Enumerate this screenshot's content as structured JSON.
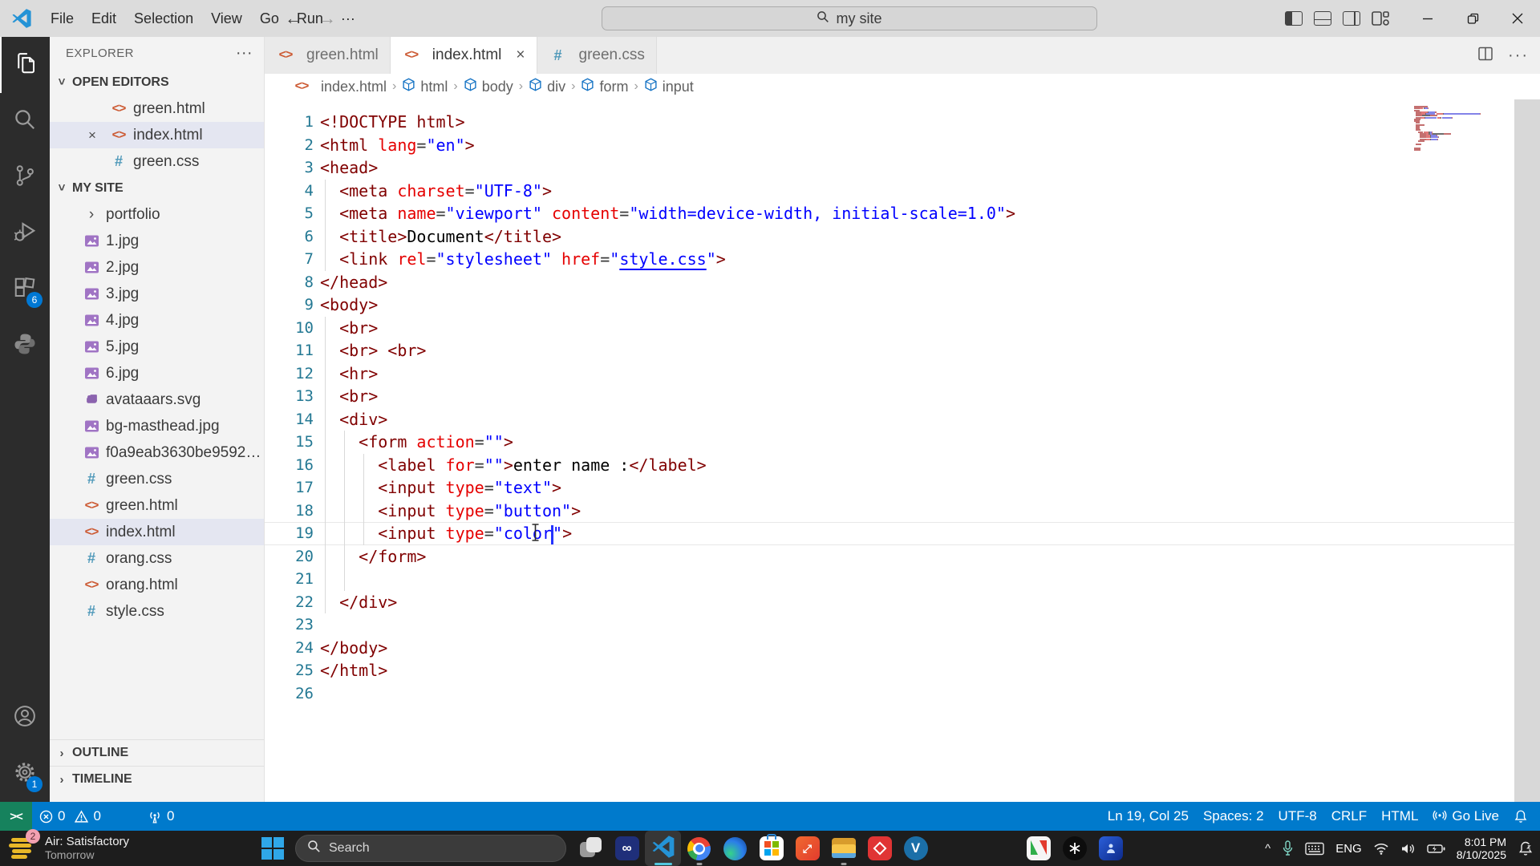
{
  "title_bar": {
    "menus": [
      "File",
      "Edit",
      "Selection",
      "View",
      "Go",
      "Run",
      "···"
    ],
    "back_icon": "←",
    "forward_icon": "→",
    "command_center": {
      "icon": "search-icon",
      "text": "my site"
    },
    "layout_icons": [
      "toggle-primary-sidebar-icon",
      "toggle-panel-icon",
      "toggle-secondary-sidebar-icon",
      "customize-layout-icon"
    ],
    "window_controls": [
      "minimize-icon",
      "restore-icon",
      "close-icon"
    ]
  },
  "activity_bar": {
    "top": [
      {
        "name": "explorer",
        "icon": "files-icon",
        "active": true
      },
      {
        "name": "search",
        "icon": "search-icon"
      },
      {
        "name": "source-control",
        "icon": "source-control-icon"
      },
      {
        "name": "run-debug",
        "icon": "run-debug-icon"
      },
      {
        "name": "extensions",
        "icon": "extensions-icon",
        "badge": "6"
      },
      {
        "name": "python",
        "icon": "python-icon"
      }
    ],
    "bottom": [
      {
        "name": "accounts",
        "icon": "account-icon"
      },
      {
        "name": "settings",
        "icon": "gear-icon",
        "badge": "1"
      }
    ]
  },
  "sidebar": {
    "title": "EXPLORER",
    "more_icon": "···",
    "open_editors": {
      "label": "OPEN EDITORS",
      "items": [
        {
          "label": "green.html",
          "icon": "html"
        },
        {
          "label": "index.html",
          "icon": "html",
          "close": true,
          "selected": true
        },
        {
          "label": "green.css",
          "icon": "css"
        }
      ]
    },
    "folder": {
      "label": "MY SITE",
      "items": [
        {
          "label": "portfolio",
          "icon": "folder"
        },
        {
          "label": "1.jpg",
          "icon": "image"
        },
        {
          "label": "2.jpg",
          "icon": "image"
        },
        {
          "label": "3.jpg",
          "icon": "image"
        },
        {
          "label": "4.jpg",
          "icon": "image"
        },
        {
          "label": "5.jpg",
          "icon": "image"
        },
        {
          "label": "6.jpg",
          "icon": "image"
        },
        {
          "label": "avataaars.svg",
          "icon": "svg"
        },
        {
          "label": "bg-masthead.jpg",
          "icon": "image"
        },
        {
          "label": "f0a9eab3630be95922...",
          "icon": "image"
        },
        {
          "label": "green.css",
          "icon": "css"
        },
        {
          "label": "green.html",
          "icon": "html"
        },
        {
          "label": "index.html",
          "icon": "html",
          "selected": true
        },
        {
          "label": "orang.css",
          "icon": "css"
        },
        {
          "label": "orang.html",
          "icon": "html"
        },
        {
          "label": "style.css",
          "icon": "css"
        }
      ]
    },
    "bottom_sections": [
      "OUTLINE",
      "TIMELINE"
    ]
  },
  "tabs": [
    {
      "label": "green.html",
      "icon": "html"
    },
    {
      "label": "index.html",
      "icon": "html",
      "active": true,
      "close": "×"
    },
    {
      "label": "green.css",
      "icon": "css"
    }
  ],
  "editor_actions": [
    "split-editor-icon",
    "more-actions-icon"
  ],
  "breadcrumb": [
    {
      "label": "index.html",
      "icon": "html"
    },
    {
      "label": "html",
      "icon": "symbol"
    },
    {
      "label": "body",
      "icon": "symbol"
    },
    {
      "label": "div",
      "icon": "symbol"
    },
    {
      "label": "form",
      "icon": "symbol"
    },
    {
      "label": "input",
      "icon": "symbol"
    }
  ],
  "editor": {
    "current_line": 19,
    "lines": [
      {
        "g": 0,
        "s": [
          [
            "tag",
            "<!DOCTYPE html>"
          ]
        ]
      },
      {
        "g": 0,
        "s": [
          [
            "tag",
            "<html "
          ],
          [
            "attr",
            "lang"
          ],
          [
            "pun",
            "="
          ],
          [
            "val",
            "\"en\""
          ],
          [
            "tag",
            ">"
          ]
        ]
      },
      {
        "g": 0,
        "s": [
          [
            "tag",
            "<head>"
          ]
        ]
      },
      {
        "g": 1,
        "s": [
          [
            "tag",
            "  <meta "
          ],
          [
            "attr",
            "charset"
          ],
          [
            "pun",
            "="
          ],
          [
            "val",
            "\"UTF-8\""
          ],
          [
            "tag",
            ">"
          ]
        ]
      },
      {
        "g": 1,
        "s": [
          [
            "tag",
            "  <meta "
          ],
          [
            "attr",
            "name"
          ],
          [
            "pun",
            "="
          ],
          [
            "val",
            "\"viewport\""
          ],
          [
            "attr",
            " content"
          ],
          [
            "pun",
            "="
          ],
          [
            "val",
            "\"width=device-width, initial-scale=1.0\""
          ],
          [
            "tag",
            ">"
          ]
        ]
      },
      {
        "g": 1,
        "s": [
          [
            "tag",
            "  <title>"
          ],
          [
            "txt",
            "Document"
          ],
          [
            "tag",
            "</title>"
          ]
        ]
      },
      {
        "g": 1,
        "s": [
          [
            "tag",
            "  <link "
          ],
          [
            "attr",
            "rel"
          ],
          [
            "pun",
            "="
          ],
          [
            "val",
            "\"stylesheet\""
          ],
          [
            "attr",
            " href"
          ],
          [
            "pun",
            "="
          ],
          [
            "val",
            "\""
          ],
          [
            "link",
            "style.css"
          ],
          [
            "val",
            "\""
          ],
          [
            "tag",
            ">"
          ]
        ]
      },
      {
        "g": 0,
        "s": [
          [
            "tag",
            "</head>"
          ]
        ]
      },
      {
        "g": 0,
        "s": [
          [
            "tag",
            "<body>"
          ]
        ]
      },
      {
        "g": 1,
        "s": [
          [
            "tag",
            "  <br>"
          ]
        ]
      },
      {
        "g": 1,
        "s": [
          [
            "tag",
            "  <br> <br>"
          ]
        ]
      },
      {
        "g": 1,
        "s": [
          [
            "tag",
            "  <hr>"
          ]
        ]
      },
      {
        "g": 1,
        "s": [
          [
            "tag",
            "  <br>"
          ]
        ]
      },
      {
        "g": 1,
        "s": [
          [
            "tag",
            "  <div>"
          ]
        ]
      },
      {
        "g": 2,
        "s": [
          [
            "tag",
            "    <form "
          ],
          [
            "attr",
            "action"
          ],
          [
            "pun",
            "="
          ],
          [
            "val",
            "\"\""
          ],
          [
            "tag",
            ">"
          ]
        ]
      },
      {
        "g": 3,
        "s": [
          [
            "tag",
            "      <label "
          ],
          [
            "attr",
            "for"
          ],
          [
            "pun",
            "="
          ],
          [
            "val",
            "\"\""
          ],
          [
            "tag",
            ">"
          ],
          [
            "txt",
            "enter name :"
          ],
          [
            "tag",
            "</label>"
          ]
        ]
      },
      {
        "g": 3,
        "s": [
          [
            "tag",
            "      <input "
          ],
          [
            "attr",
            "type"
          ],
          [
            "pun",
            "="
          ],
          [
            "val",
            "\"text\""
          ],
          [
            "tag",
            ">"
          ]
        ]
      },
      {
        "g": 3,
        "s": [
          [
            "tag",
            "      <input "
          ],
          [
            "attr",
            "type"
          ],
          [
            "pun",
            "="
          ],
          [
            "val",
            "\"button\""
          ],
          [
            "tag",
            ">"
          ]
        ]
      },
      {
        "g": 3,
        "s": [
          [
            "tag",
            "      <input "
          ],
          [
            "attr",
            "type"
          ],
          [
            "pun",
            "="
          ],
          [
            "val",
            "\""
          ],
          [
            "hl",
            "color"
          ],
          [
            "caret",
            ""
          ],
          [
            "val",
            "\""
          ],
          [
            "tag",
            ">"
          ]
        ]
      },
      {
        "g": 2,
        "s": [
          [
            "tag",
            "    </form>"
          ]
        ]
      },
      {
        "g": 2,
        "s": []
      },
      {
        "g": 1,
        "s": [
          [
            "tag",
            "  </div>"
          ]
        ]
      },
      {
        "g": 0,
        "s": []
      },
      {
        "g": 0,
        "s": [
          [
            "tag",
            "</body>"
          ]
        ]
      },
      {
        "g": 0,
        "s": [
          [
            "tag",
            "</html>"
          ]
        ]
      },
      {
        "g": 0,
        "s": []
      }
    ]
  },
  "status_bar": {
    "remote_icon": "><",
    "problems": {
      "errors": "0",
      "warnings": "0"
    },
    "ports": "0",
    "right": [
      {
        "name": "cursor-position",
        "text": "Ln 19, Col 25"
      },
      {
        "name": "indentation",
        "text": "Spaces: 2"
      },
      {
        "name": "encoding",
        "text": "UTF-8"
      },
      {
        "name": "eol",
        "text": "CRLF"
      },
      {
        "name": "language-mode",
        "text": "HTML"
      },
      {
        "name": "go-live",
        "icon": "broadcast",
        "text": "Go Live"
      },
      {
        "name": "notifications",
        "icon": "bell"
      }
    ]
  },
  "taskbar": {
    "weather": {
      "badge": "2",
      "line1": "Air: Satisfactory",
      "line2": "Tomorrow"
    },
    "search": {
      "icon": "search-icon",
      "text": "Search"
    },
    "apps": [
      {
        "name": "task-view"
      },
      {
        "name": "visual-studio"
      },
      {
        "name": "vscode",
        "active": true,
        "running": true
      },
      {
        "name": "chrome",
        "running": true
      },
      {
        "name": "edge"
      },
      {
        "name": "microsoft-store"
      },
      {
        "name": "app-red-arrows"
      },
      {
        "name": "file-explorer",
        "running": true
      },
      {
        "name": "app-red-media"
      },
      {
        "name": "app-blue-v"
      }
    ],
    "apps2": [
      {
        "name": "app-colorful"
      },
      {
        "name": "chatgpt"
      },
      {
        "name": "app-blue-ai"
      }
    ],
    "tray": {
      "chevron": "^",
      "lang": "ENG",
      "time": "8:01 PM",
      "date": "8/10/2025"
    }
  }
}
